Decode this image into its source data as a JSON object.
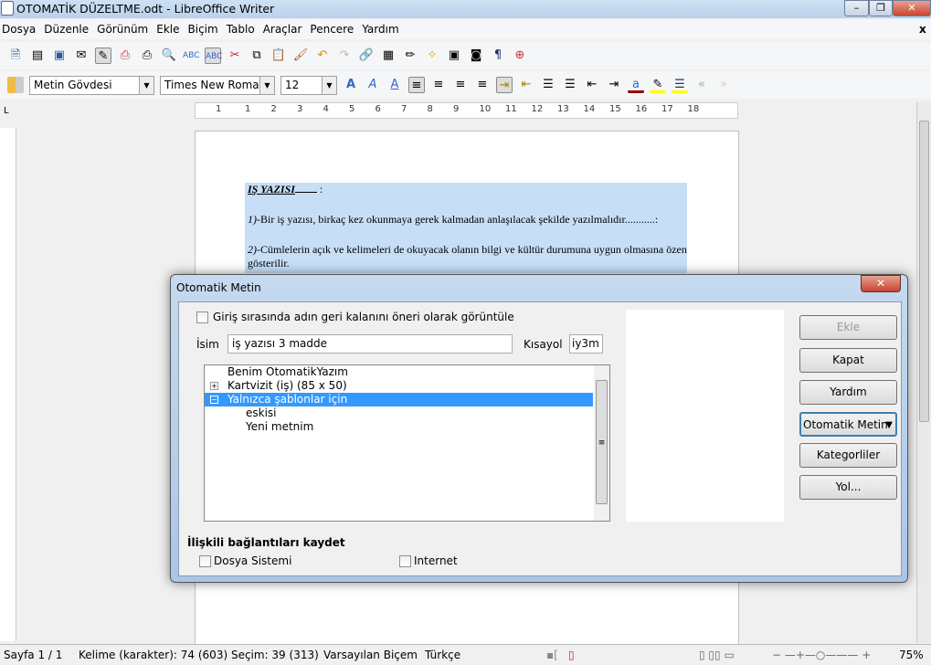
{
  "window": {
    "title": "OTOMATİK DÜZELTME.odt - LibreOffice Writer"
  },
  "menu": [
    "Dosya",
    "Düzenle",
    "Görünüm",
    "Ekle",
    "Biçim",
    "Tablo",
    "Araçlar",
    "Pencere",
    "Yardım"
  ],
  "format_toolbar": {
    "paragraph_style": "Metin Gövdesi",
    "font_name": "Times New Roman",
    "font_size": "12"
  },
  "ruler": {
    "labels": [
      "1",
      "1",
      "2",
      "3",
      "4",
      "5",
      "6",
      "7",
      "8",
      "9",
      "10",
      "11",
      "12",
      "13",
      "14",
      "15",
      "16",
      "17",
      "18"
    ]
  },
  "document": {
    "heading": "IŞ YAZISI",
    "heading_suffix": ":",
    "item1_num": "1)",
    "item1": "-Bir iş yazısı, birkaç kez okunmaya gerek kalmadan anlaşılacak şekilde yazılmalıdır...........:",
    "item2_num": "2)",
    "item2": "-Cümlelerin açık ve kelimeleri de okuyacak olanın bilgi ve kültür durumuna uygun olmasına özen",
    "item2_cont": "gösterilir."
  },
  "dialog": {
    "title": "Otomatik Metin",
    "close": "✕",
    "show_remainder_label": "Giriş sırasında adın geri kalanını öneri olarak görüntüle",
    "name_label": "İsim",
    "name_value": "iş yazısı 3 madde",
    "shortcut_label": "Kısayol",
    "shortcut_value": "iy3m",
    "tree": [
      {
        "label": "Benim OtomatikYazım",
        "expander": ""
      },
      {
        "label": "Kartvizit (iş) (85 x 50)",
        "expander": "+"
      },
      {
        "label": "Yalnızca şablonlar için",
        "expander": "−",
        "selected": true
      },
      {
        "label": "eskisi",
        "expander": ""
      },
      {
        "label": "Yeni metnim",
        "expander": ""
      }
    ],
    "buttons": {
      "insert": "Ekle",
      "close": "Kapat",
      "help": "Yardım",
      "autotext": "Otomatik Metin",
      "categories": "Kategorliler",
      "path": "Yol..."
    },
    "save_links_label": "İlişkili bağlantıları kaydet",
    "file_system": "Dosya Sistemi",
    "internet": "Internet"
  },
  "status": {
    "page": "Sayfa 1 / 1",
    "words": "Kelime (karakter): 74 (603) Seçim: 39 (313)",
    "style": "Varsayılan Biçem",
    "language": "Türkçe",
    "zoom": "75%"
  },
  "colors": {
    "selection": "#c6dff7",
    "tree_selected": "#3399ff"
  }
}
